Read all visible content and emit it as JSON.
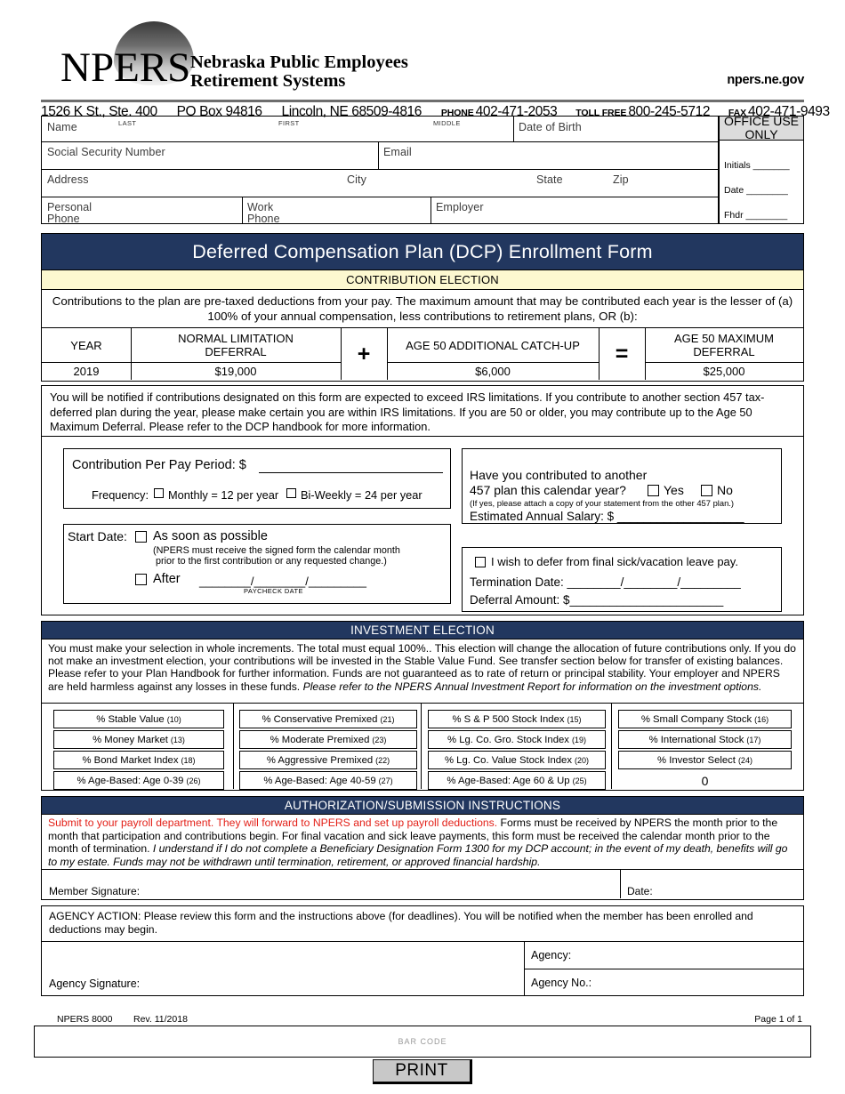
{
  "letterhead": {
    "logo_text": "NPERS",
    "org_line1": "Nebraska Public Employees",
    "org_line2": "Retirement Systems",
    "website": "npers.ne.gov",
    "street": "1526 K St., Ste. 400",
    "po_box": "PO Box 94816",
    "city_state_zip": "Lincoln, NE 68509-4816",
    "phone_label": "PHONE",
    "phone": "402-471-2053",
    "tollfree_label": "TOLL FREE",
    "tollfree": "800-245-5712",
    "fax_label": "FAX",
    "fax": "402-471-9493"
  },
  "info": {
    "name": "Name",
    "last": "LAST",
    "first": "FIRST",
    "middle": "MIDDLE",
    "dob": "Date of Birth",
    "ssn": "Social Security Number",
    "email": "Email",
    "address": "Address",
    "city": "City",
    "state": "State",
    "zip": "Zip",
    "personal_phone": "Personal\nPhone",
    "personal_phone_l1": "Personal",
    "personal_phone_l2": "Phone",
    "work_phone_l1": "Work",
    "work_phone_l2": "Phone",
    "employer": "Employer",
    "office_use": "OFFICE USE ONLY",
    "office_initials": "Initials _______",
    "office_date": "Date ________",
    "office_fhdr": "Fhdr ________"
  },
  "title": "Deferred Compensation Plan (DCP) Enrollment Form",
  "contribution": {
    "band": "CONTRIBUTION ELECTION",
    "intro": "Contributions to the plan are pre-taxed deductions from your pay. The maximum amount that may be contributed each year is the lesser of (a) 100% of your annual compensation, less contributions to retirement plans, OR (b):",
    "limits_headers": [
      "YEAR",
      "NORMAL LIMITATION DEFERRAL",
      "AGE 50 ADDITIONAL CATCH-UP",
      "AGE 50 MAXIMUM DEFERRAL"
    ],
    "limits_header_year": "YEAR",
    "limits_header_normal_l1": "NORMAL LIMITATION",
    "limits_header_normal_l2": "DEFERRAL",
    "limits_header_catchup": "AGE 50 ADDITIONAL CATCH-UP",
    "limits_header_max_l1": "AGE 50 MAXIMUM",
    "limits_header_max_l2": "DEFERRAL",
    "operator_plus": "+",
    "operator_equals": "=",
    "limits_values": {
      "year": "2019",
      "normal": "$19,000",
      "catchup": "$6,000",
      "maximum": "$25,000"
    },
    "notice": "You will be notified if contributions designated on this form are expected to exceed IRS limitations. If you contribute to another section 457 tax-deferred plan during the year, please make certain you are within IRS limitations. If you are 50 or older, you may contribute up to the Age 50 Maximum Deferral. Please refer to the DCP handbook for more information.",
    "per_pay_label": "Contribution Per Pay Period:  $",
    "per_pay_value": "",
    "frequency_label": "Frequency:",
    "freq_monthly": "Monthly = 12 per year",
    "freq_biweekly": "Bi-Weekly = 24 per year",
    "start_date_label": "Start Date:",
    "asap_label": "As soon as possible",
    "asap_note_l1": "(NPERS must receive the signed form the calendar month",
    "asap_note_l2": "prior to the first contribution or any requested change.)",
    "after_label": "After",
    "after_date_line": "________/________/_________",
    "paycheck_date": "PAYCHECK DATE",
    "another_plan_l1": "Have you contributed to another",
    "another_plan_l2": "457 plan this calendar year?",
    "yes_label": "Yes",
    "no_label": "No",
    "another_plan_note": "(If yes, please attach a copy of your statement from the other 457 plan.)",
    "salary_label": "Estimated Annual Salary:  $ ___________________",
    "sick_vacation_label": "I wish to defer from final sick/vacation leave pay.",
    "termination_label": "Termination Date:  ________/________/_________",
    "deferral_amount_label": "Deferral Amount:  $_______________________"
  },
  "investment": {
    "band": "INVESTMENT ELECTION",
    "text_plain": "You must make your selection in whole increments. The total must equal 100%.. This election will change the allocation of future contributions only. If you do not make an investment election, your contributions will be invested in the Stable Value Fund. See transfer section below for transfer of existing balances. Please refer to your Plan Handbook for further information. Funds are not guaranteed as to rate of return or principal stability. Your employer and NPERS are held harmless against any losses in these funds.",
    "text_italic": "Please refer to the NPERS Annual Investment Report for information on the investment options.",
    "funds": [
      [
        {
          "label": "% Stable Value",
          "num": "(10)"
        },
        {
          "label": "% Money Market",
          "num": "(13)"
        },
        {
          "label": "% Bond Market Index",
          "num": "(18)"
        },
        {
          "label": "% Age-Based: Age 0-39",
          "num": "(26)"
        }
      ],
      [
        {
          "label": "% Conservative Premixed",
          "num": "(21)"
        },
        {
          "label": "% Moderate Premixed",
          "num": "(23)"
        },
        {
          "label": "% Aggressive Premixed",
          "num": "(22)"
        },
        {
          "label": "% Age-Based: Age 40-59",
          "num": "(27)"
        }
      ],
      [
        {
          "label": "% S & P 500 Stock Index",
          "num": "(15)"
        },
        {
          "label": "% Lg. Co. Gro. Stock Index",
          "num": "(19)"
        },
        {
          "label": "% Lg. Co. Value Stock Index",
          "num": "(20)"
        },
        {
          "label": "% Age-Based: Age 60 & Up",
          "num": "(25)"
        }
      ],
      [
        {
          "label": "% Small Company Stock",
          "num": "(16)"
        },
        {
          "label": "% International Stock",
          "num": "(17)"
        },
        {
          "label": "% Investor Select",
          "num": "(24)"
        }
      ]
    ],
    "total": "0"
  },
  "authorization": {
    "band": "AUTHORIZATION/SUBMISSION INSTRUCTIONS",
    "red_text": "Submit to your payroll department. They will forward to NPERS and set up payroll deductions.",
    "plain_text": " Forms must be received by NPERS the month prior to the month that participation and contributions begin. For final vacation and sick leave payments, this form must be received the calendar month prior to the month of termination. ",
    "italic_text": "I understand if I do not complete a Beneficiary Designation Form 1300 for my DCP account; in the event of my death, benefits will go to my estate. Funds may not be withdrawn until termination, retirement, or approved financial hardship.",
    "member_signature": "Member Signature:",
    "date": "Date:",
    "agency_action": "AGENCY ACTION: Please review this form and the instructions above (for deadlines). You will be notified when the member has been enrolled and deductions may begin.",
    "agency_signature": "Agency Signature:",
    "agency": "Agency:",
    "agency_no": "Agency No.:"
  },
  "footer": {
    "form_no": "NPERS 8000",
    "rev": "Rev. 11/2018",
    "page": "Page 1 of 1",
    "barcode": "BAR CODE",
    "print": "PRINT"
  },
  "colors": {
    "navy": "#22375f",
    "cream": "#fcf8d0",
    "red": "#e32119",
    "grey": "#dcdcdc"
  }
}
